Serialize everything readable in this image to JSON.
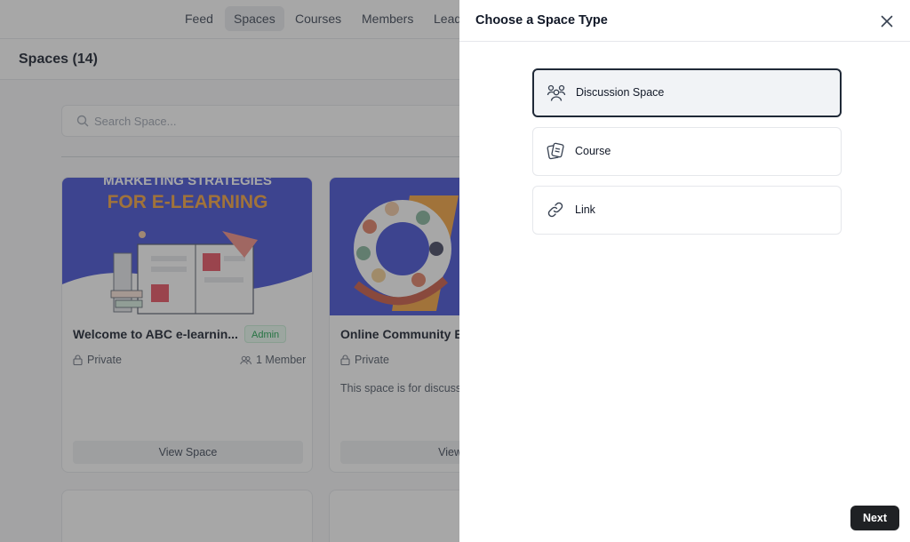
{
  "nav": {
    "items": [
      "Feed",
      "Spaces",
      "Courses",
      "Members",
      "Lead"
    ],
    "active": "Spaces"
  },
  "page": {
    "title": "Spaces (14)",
    "search_placeholder": "Search Space..."
  },
  "cards": [
    {
      "banner_text_line1": "MARKETING STRATEGIES",
      "banner_text_line2": "FOR E-LEARNING",
      "title": "Welcome to ABC e-learnin...",
      "badge": "Admin",
      "privacy": "Private",
      "members": "1 Member",
      "description": "",
      "button": "View Space"
    },
    {
      "title": "Online Community En",
      "privacy": "Private",
      "description": "This space is for discuss an online community",
      "button": "View S"
    }
  ],
  "panel": {
    "title": "Choose a Space Type",
    "options": [
      {
        "label": "Discussion Space",
        "icon": "people-icon",
        "selected": true
      },
      {
        "label": "Course",
        "icon": "course-cards-icon",
        "selected": false
      },
      {
        "label": "Link",
        "icon": "link-icon",
        "selected": false
      }
    ],
    "next_label": "Next"
  },
  "colors": {
    "accent_dark": "#1f2124",
    "banner_blue": "#3f4bd4",
    "banner_orange": "#f4a13a",
    "badge_green": "#16a34a"
  }
}
